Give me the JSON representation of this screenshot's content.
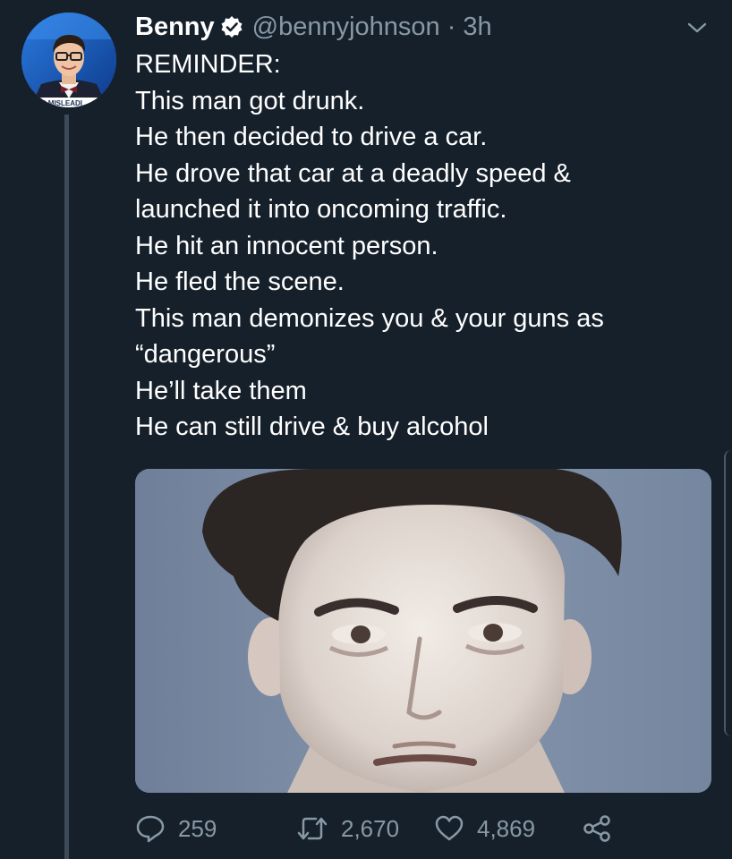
{
  "tweet": {
    "author": {
      "display_name": "Benny",
      "handle": "@bennyjohnson",
      "verified": true,
      "avatar_icon": "profile-photo",
      "avatar_caption": "VISES MISLEADI"
    },
    "separator": "·",
    "time": "3h",
    "text_lines": [
      "REMINDER:",
      "This man got drunk.",
      "He then decided to drive a car.",
      "He drove that car at a deadly speed &",
      "launched it into oncoming traffic.",
      "He hit an innocent person.",
      "He fled the scene.",
      "This man demonizes you & your guns as",
      "“dangerous”",
      "He’ll take them",
      "He can still drive & buy alcohol"
    ],
    "media": {
      "type": "photo",
      "subject": "mugshot-photo"
    },
    "actions": {
      "reply": {
        "icon": "reply-icon",
        "count": "259"
      },
      "retweet": {
        "icon": "retweet-icon",
        "count": "2,670"
      },
      "like": {
        "icon": "heart-icon",
        "count": "4,869"
      },
      "share": {
        "icon": "share-icon"
      }
    }
  },
  "colors": {
    "background": "#16202b",
    "primary_text": "#ffffff",
    "secondary_text": "#8899a6",
    "thread_line": "#3d4a57"
  }
}
